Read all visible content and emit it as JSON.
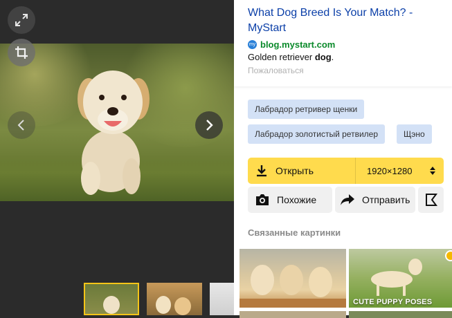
{
  "viewer": {
    "expand_icon": "expand-arrows-icon",
    "crop_icon": "crop-icon",
    "prev_icon": "chevron-left-icon",
    "next_icon": "chevron-right-icon"
  },
  "result": {
    "title": "What Dog Breed Is Your Match? - MyStart",
    "favicon_text": "my",
    "source": "blog.mystart.com",
    "snippet_prefix": "Golden retriever ",
    "snippet_bold": "dog",
    "snippet_suffix": ".",
    "complain": "Пожаловаться"
  },
  "tags": [
    {
      "label": "Лабрадор ретривер щенки"
    },
    {
      "label": "Лабрадор золотистый ретвилер"
    },
    {
      "label": "Щэно"
    }
  ],
  "open": {
    "label": "Открыть",
    "size": "1920×1280"
  },
  "actions": {
    "similar": "Похожие",
    "send": "Отправить"
  },
  "related": {
    "title": "Связанные картинки",
    "caption2": "CUTE PUPPY POSES"
  },
  "colors": {
    "accent": "#ffdb4d",
    "link": "#0b3fa8",
    "source": "#0a8a2a",
    "tag_bg": "#d3e1f6"
  }
}
